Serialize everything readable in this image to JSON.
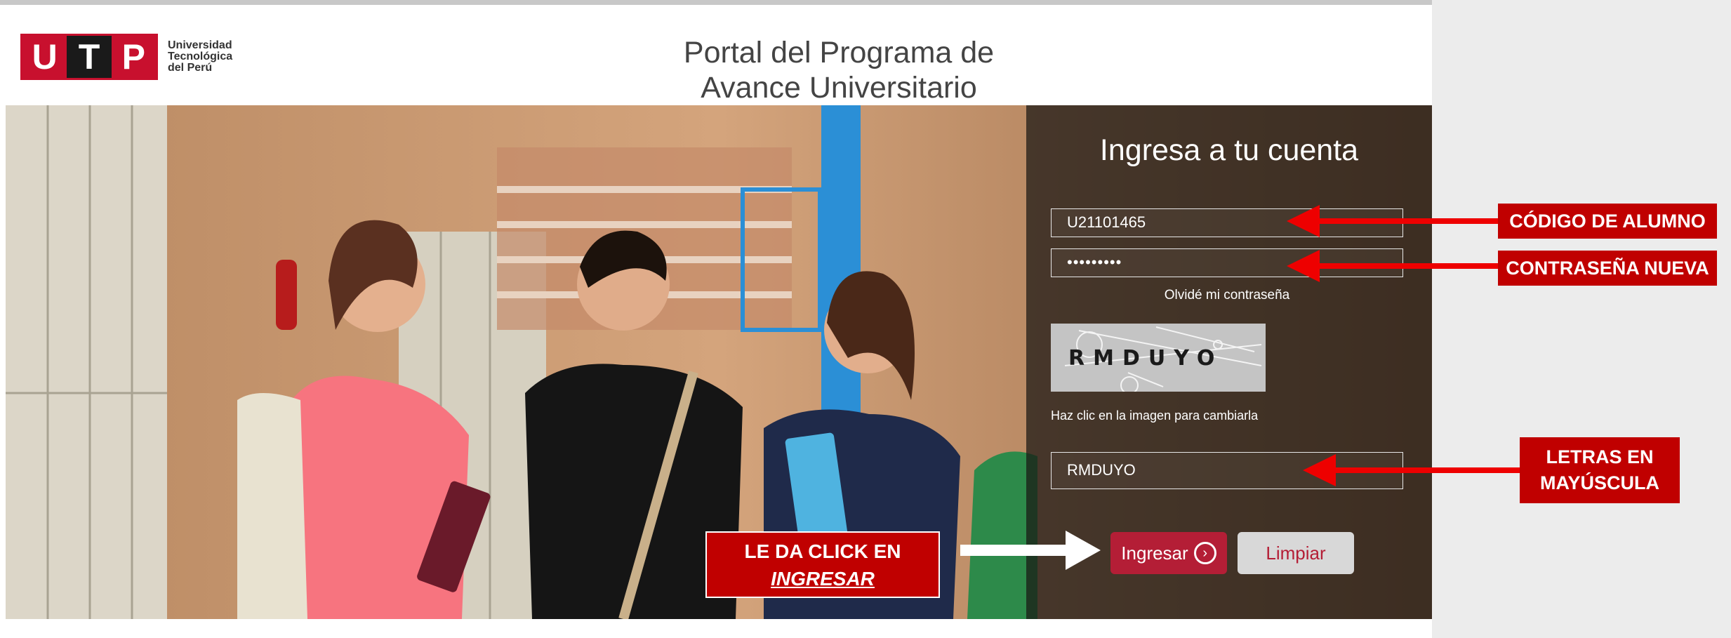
{
  "header": {
    "logo_letters": [
      "U",
      "T",
      "P"
    ],
    "logo_lines": [
      "Universidad",
      "Tecnológica",
      "del Perú"
    ],
    "portal_title_line1": "Portal del Programa de",
    "portal_title_line2": "Avance Universitario"
  },
  "login": {
    "title": "Ingresa a tu cuenta",
    "student_code_value": "U21101465",
    "password_value": "•••••••••",
    "forgot_link": "Olvidé mi contraseña",
    "captcha_text": "RMDUYO",
    "captcha_hint": "Haz clic en la imagen para cambiarla",
    "captcha_input_value": "RMDUYO",
    "submit_label": "Ingresar",
    "submit_icon": "chevron-right-circle-icon",
    "clear_label": "Limpiar"
  },
  "annotations": {
    "codigo": "CÓDIGO DE ALUMNO",
    "contrasena": "CONTRASEÑA NUEVA",
    "letras_line1": "LETRAS EN",
    "letras_line2": "MAYÚSCULA",
    "click_line1": "LE DA CLICK EN",
    "click_line2": "INGRESAR"
  },
  "colors": {
    "brand_red": "#c8102e",
    "button_red": "#b41e36",
    "annotation_red": "#c00000"
  }
}
